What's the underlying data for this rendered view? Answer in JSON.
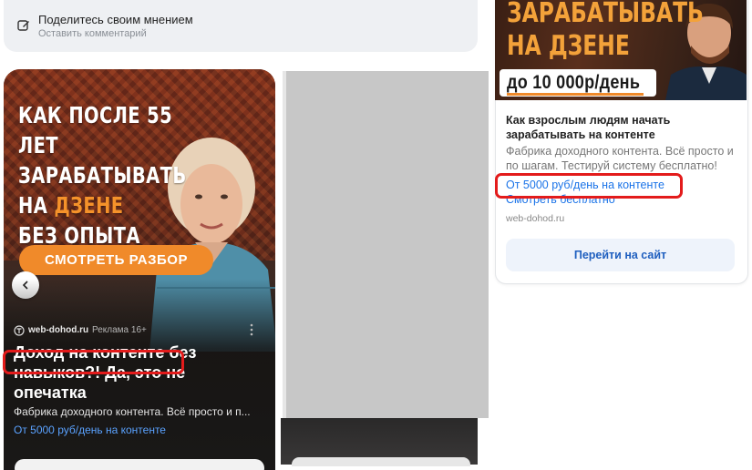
{
  "comment": {
    "title": "Поделитесь своим мнением",
    "subtitle": "Оставить комментарий",
    "icon": "edit-icon"
  },
  "main_ad": {
    "headline_lines": [
      "КАК ПОСЛЕ 55 ЛЕТ",
      "ЗАРАБАТЫВАТЬ",
      "НА ",
      "ДЗЕНЕ",
      "БЕЗ ОПЫТА"
    ],
    "cta": "СМОТРЕТЬ РАЗБОР",
    "source_domain": "web-dohod.ru",
    "ad_label": "Реклама 16+",
    "title": "Доход на контенте без навыков?! Да, это не опечатка",
    "description": "Фабрика доходного контента. Всё просто и п...",
    "link": "От 5000 руб/день на контенте",
    "accent_color": "#f08a2a",
    "highlight_color": "#e31b1b"
  },
  "side_ad": {
    "banner_line1": "ЗАРАБАТЫВАТЬ",
    "banner_line2": "НА ДЗЕНЕ",
    "banner_price": "до 10 000р/день",
    "title": "Как взрослым людям начать зарабатывать на контенте",
    "description": "Фабрика доходного контента. Всё просто и по шагам. Тестируй систему бесплатно!",
    "link1": "От 5000 руб/день на контенте",
    "link2": "Смотреть бесплатно",
    "domain": "web-dohod.ru",
    "button": "Перейти на сайт",
    "link_color": "#1a73e8"
  }
}
